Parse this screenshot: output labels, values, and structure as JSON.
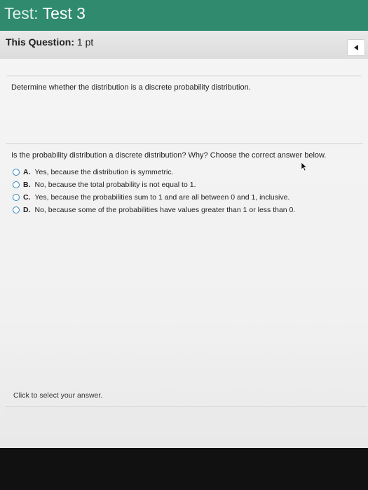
{
  "header": {
    "label": "Test:",
    "name": "Test 3"
  },
  "subbar": {
    "label": "This Question:",
    "value": "1 pt"
  },
  "question": {
    "stem": "Determine whether the distribution is a discrete probability distribution.",
    "prompt": "Is the probability distribution a discrete distribution? Why? Choose the correct answer below.",
    "options": [
      {
        "letter": "A.",
        "text": "Yes, because the distribution is symmetric."
      },
      {
        "letter": "B.",
        "text": "No, because the total probability is not equal to 1."
      },
      {
        "letter": "C.",
        "text": "Yes, because the probabilities sum to 1 and are all between 0 and 1, inclusive."
      },
      {
        "letter": "D.",
        "text": "No, because some of the probabilities have values greater than 1 or less than 0."
      }
    ]
  },
  "footer": {
    "hint": "Click to select your answer."
  },
  "colors": {
    "header_bg": "#2f8a6e",
    "radio_border": "#2e86c1"
  },
  "icons": {
    "collapse": "chevron-left-icon",
    "pointer": "mouse-pointer-icon"
  }
}
